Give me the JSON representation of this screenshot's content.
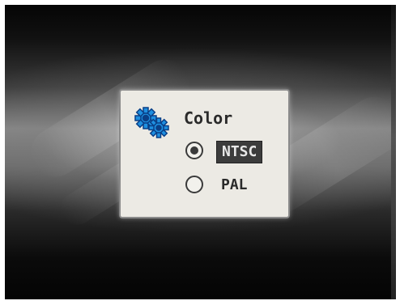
{
  "dialog": {
    "title": "Color",
    "icon": "gear-icon",
    "options": [
      {
        "label": "NTSC",
        "selected": true
      },
      {
        "label": "PAL",
        "selected": false
      }
    ]
  },
  "colors": {
    "dialog_background": "#eceae4",
    "highlight": "#3c3c3c",
    "icon_blue": "#1e8fe0",
    "text": "#2a2a2a"
  }
}
